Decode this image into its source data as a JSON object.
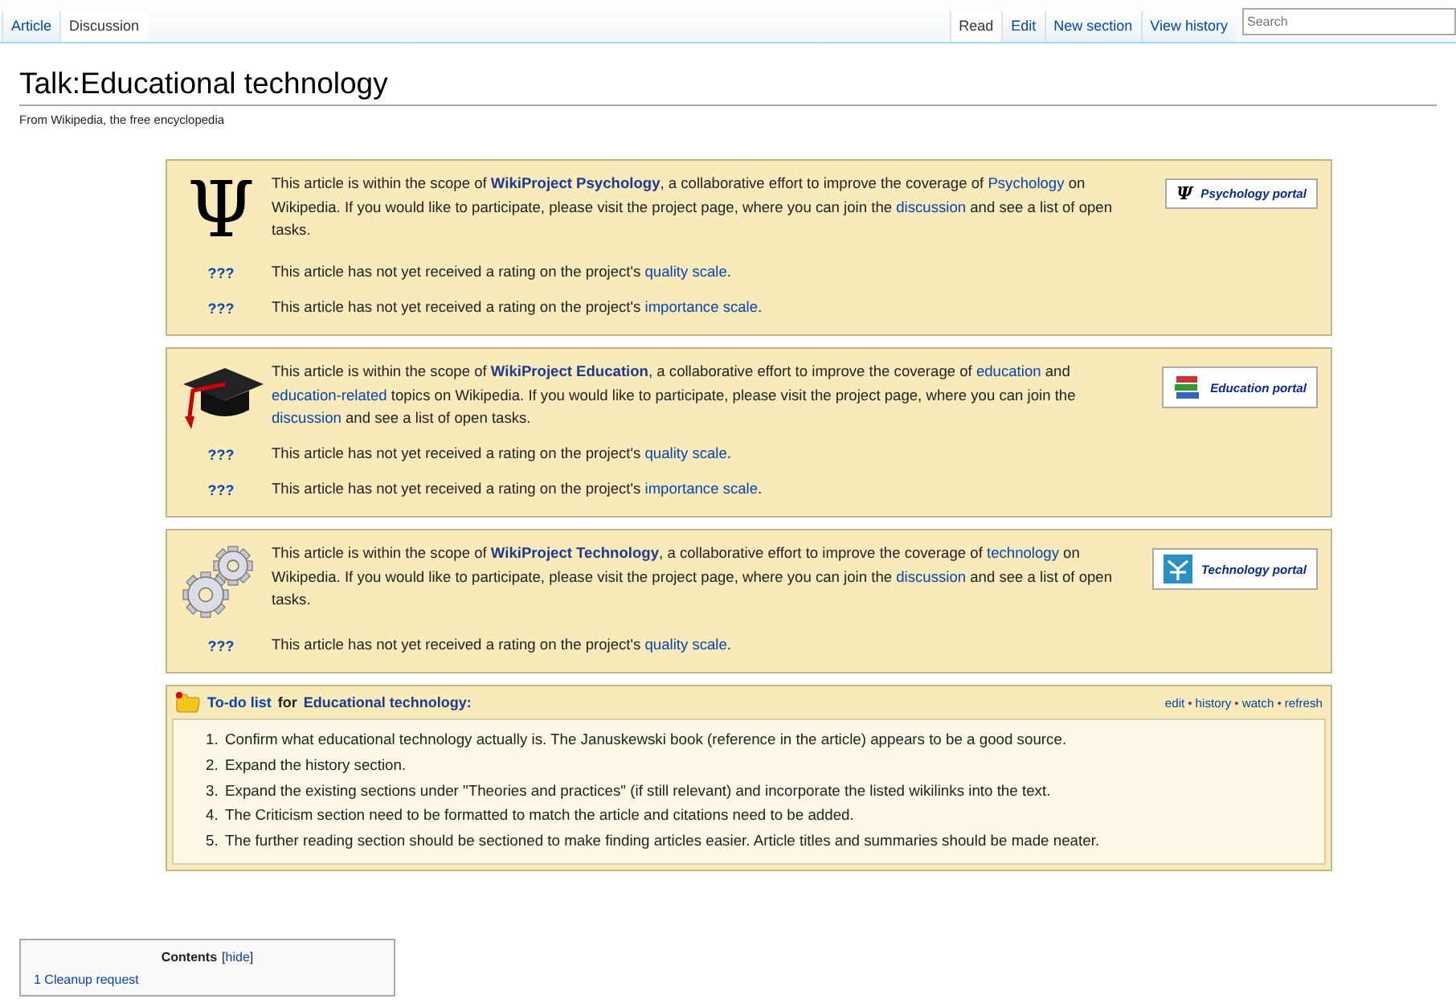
{
  "tabs_left": [
    {
      "label": "Article",
      "selected": false
    },
    {
      "label": "Discussion",
      "selected": true
    }
  ],
  "tabs_right": [
    {
      "label": "Read",
      "selected": true
    },
    {
      "label": "Edit",
      "selected": false
    },
    {
      "label": "New section",
      "selected": false
    },
    {
      "label": "View history",
      "selected": false
    }
  ],
  "search": {
    "placeholder": "Search"
  },
  "title": "Talk:Educational technology",
  "subtitle": "From Wikipedia, the free encyclopedia",
  "banners": [
    {
      "icon": {
        "kind": "symbol",
        "symbol": "Ψ"
      },
      "text": [
        {
          "kind": "plain",
          "text": "This article is within the scope of "
        },
        {
          "kind": "project",
          "text": "WikiProject Psychology"
        },
        {
          "kind": "plain",
          "text": ", a collaborative effort to improve the coverage of "
        },
        {
          "kind": "link",
          "text": "Psychology"
        },
        {
          "kind": "plain",
          "text": " on Wikipedia. If you would like to participate, please visit the project page, where you can join the "
        },
        {
          "kind": "link",
          "text": "discussion"
        },
        {
          "kind": "plain",
          "text": " and see a list of open tasks."
        }
      ],
      "portal": {
        "icon": {
          "kind": "symbol",
          "symbol": "Ψ"
        },
        "label": "Psychology portal"
      },
      "ratings": [
        {
          "grade": "???",
          "text": [
            {
              "kind": "plain",
              "text": "This article has not yet received a rating on the project's "
            },
            {
              "kind": "link",
              "text": "quality scale"
            },
            {
              "kind": "plain",
              "text": "."
            }
          ]
        },
        {
          "grade": "???",
          "text": [
            {
              "kind": "plain",
              "text": "This article has not yet received a rating on the project's "
            },
            {
              "kind": "link",
              "text": "importance scale"
            },
            {
              "kind": "plain",
              "text": "."
            }
          ]
        }
      ]
    },
    {
      "icon": {
        "kind": "cap"
      },
      "text": [
        {
          "kind": "plain",
          "text": "This article is within the scope of "
        },
        {
          "kind": "project",
          "text": "WikiProject Education"
        },
        {
          "kind": "plain",
          "text": ", a collaborative effort to improve the coverage of "
        },
        {
          "kind": "link",
          "text": "education"
        },
        {
          "kind": "plain",
          "text": " and "
        },
        {
          "kind": "link",
          "text": "education-related"
        },
        {
          "kind": "plain",
          "text": " topics on Wikipedia. If you would like to participate, please visit the project page, where you can join the "
        },
        {
          "kind": "link",
          "text": "discussion"
        },
        {
          "kind": "plain",
          "text": " and see a list of open tasks."
        }
      ],
      "portal": {
        "icon": {
          "kind": "books"
        },
        "label": "Education portal"
      },
      "ratings": [
        {
          "grade": "???",
          "text": [
            {
              "kind": "plain",
              "text": "This article has not yet received a rating on the project's "
            },
            {
              "kind": "link",
              "text": "quality scale"
            },
            {
              "kind": "plain",
              "text": "."
            }
          ]
        },
        {
          "grade": "???",
          "text": [
            {
              "kind": "plain",
              "text": "This article has not yet received a rating on the project's "
            },
            {
              "kind": "link",
              "text": "importance scale"
            },
            {
              "kind": "plain",
              "text": "."
            }
          ]
        }
      ]
    },
    {
      "icon": {
        "kind": "gears"
      },
      "text": [
        {
          "kind": "plain",
          "text": "This article is within the scope of "
        },
        {
          "kind": "project",
          "text": "WikiProject Technology"
        },
        {
          "kind": "plain",
          "text": ", a collaborative effort to improve the coverage of "
        },
        {
          "kind": "link",
          "text": "technology"
        },
        {
          "kind": "plain",
          "text": " on Wikipedia. If you would like to participate, please visit the project page, where you can join the "
        },
        {
          "kind": "link",
          "text": "discussion"
        },
        {
          "kind": "plain",
          "text": " and see a list of open tasks."
        }
      ],
      "portal": {
        "icon": {
          "kind": "tech"
        },
        "label": "Technology portal"
      },
      "ratings": [
        {
          "grade": "???",
          "text": [
            {
              "kind": "plain",
              "text": "This article has not yet received a rating on the project's "
            },
            {
              "kind": "link",
              "text": "quality scale"
            },
            {
              "kind": "plain",
              "text": "."
            }
          ]
        }
      ]
    }
  ],
  "todo": {
    "link": "To-do list",
    "joiner": "for",
    "topic": "Educational technology:",
    "actions": [
      "edit",
      "history",
      "watch",
      "refresh"
    ],
    "separator": "•",
    "items": [
      {
        "number": "1.",
        "text": "Confirm what educational technology actually is. The Januskewski book (reference in the article) appears to be a good source."
      },
      {
        "number": "2.",
        "text": "Expand the history section."
      },
      {
        "number": "3.",
        "text": "Expand the existing sections under \"Theories and practices\" (if still relevant) and incorporate the listed wikilinks into the text."
      },
      {
        "number": "4.",
        "text": "The Criticism section need to be formatted to match the article and citations need to be added."
      },
      {
        "number": "5.",
        "text": "The further reading section should be sectioned to make finding articles easier. Article titles and summaries should be made neater."
      }
    ]
  },
  "contents": {
    "title": "Contents",
    "toggle_open": "[",
    "toggle": "hide",
    "toggle_close": "]",
    "items": [
      {
        "number": "1",
        "label": "Cleanup request"
      }
    ]
  }
}
